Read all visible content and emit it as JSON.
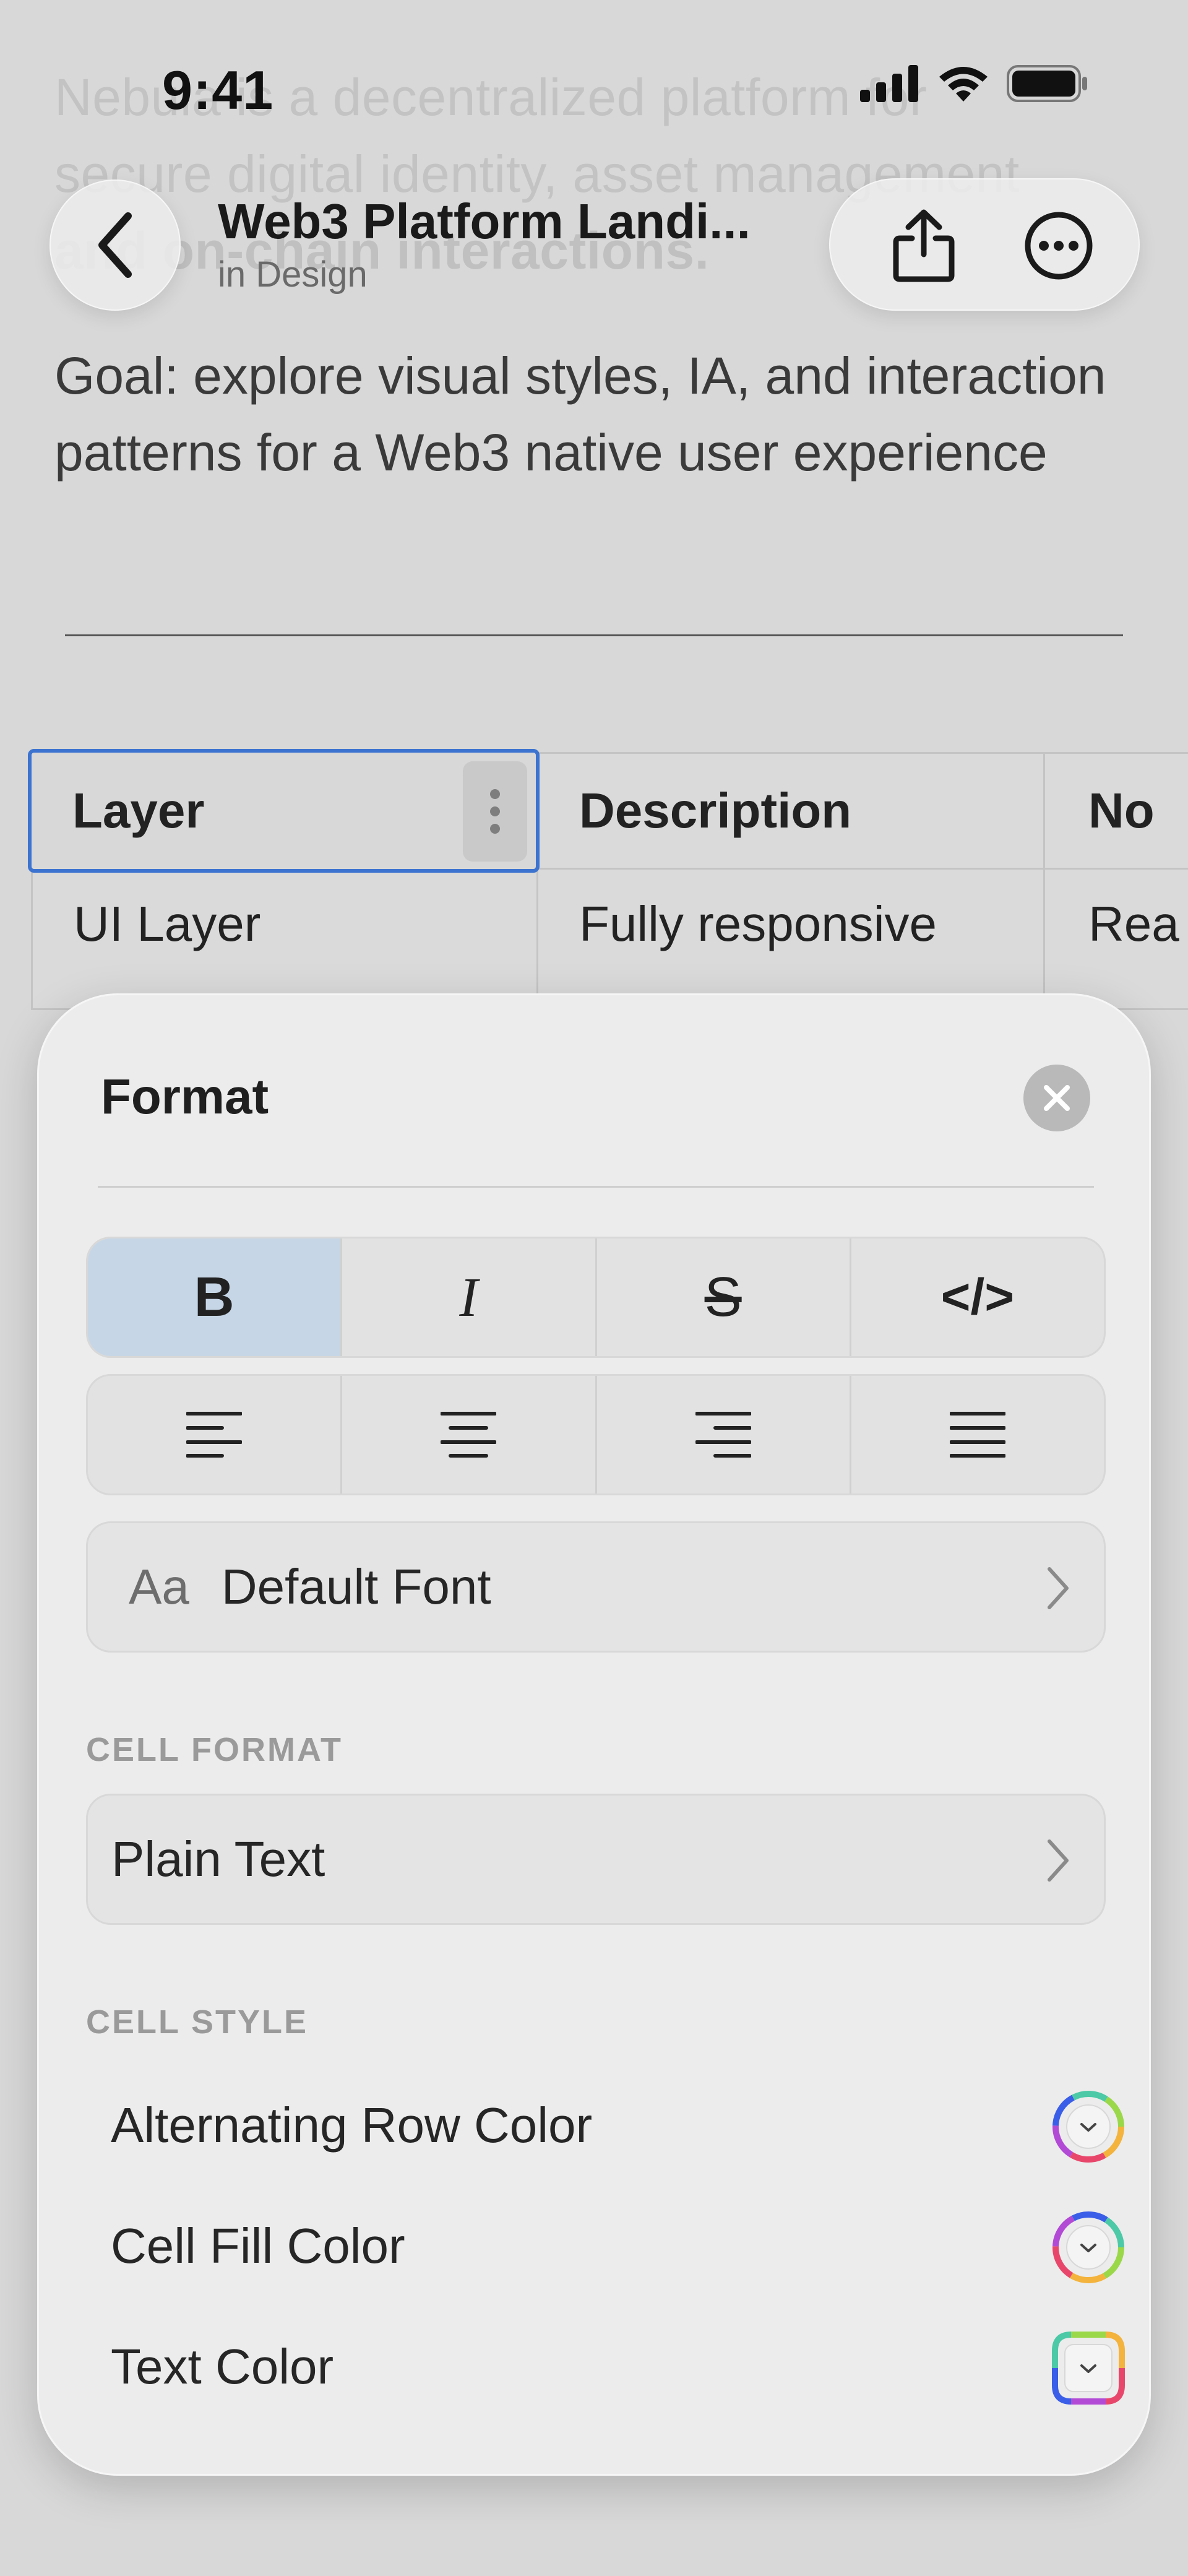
{
  "status_bar": {
    "time": "9:41"
  },
  "background": {
    "ghost_paragraph": [
      "Nebula is a decentralized platform for",
      "secure digital identity, asset management",
      "and on-chain interactions."
    ],
    "goal_text": "Goal: explore visual styles, IA, and interaction patterns for a Web3 native user experience"
  },
  "nav": {
    "title": "Web3 Platform Landi...",
    "subtitle": "in Design",
    "back_icon": "chevron-left-icon",
    "share_icon": "share-icon",
    "more_icon": "ellipsis-icon"
  },
  "table": {
    "headers": [
      "Layer",
      "Description",
      "No"
    ],
    "rows": [
      [
        "UI Layer",
        "Fully responsive",
        "Rea"
      ]
    ]
  },
  "format_sheet": {
    "title": "Format",
    "text_styles": [
      {
        "label": "B",
        "name": "bold",
        "active": true
      },
      {
        "label": "I",
        "name": "italic",
        "active": false
      },
      {
        "label": "S",
        "name": "strikethrough",
        "active": false
      },
      {
        "label": "</>",
        "name": "code",
        "active": false
      }
    ],
    "alignments": [
      "align-left",
      "align-center",
      "align-right",
      "align-justify"
    ],
    "font_row": {
      "prefix": "Aa",
      "label": "Default Font"
    },
    "cell_format": {
      "caption": "CELL FORMAT",
      "value": "Plain Text"
    },
    "cell_style": {
      "caption": "CELL STYLE",
      "items": [
        {
          "label": "Alternating Row Color"
        },
        {
          "label": "Cell Fill Color"
        },
        {
          "label": "Text Color"
        }
      ]
    },
    "active_color": "#c6d6e6",
    "selection_color": "#3d73d0"
  }
}
